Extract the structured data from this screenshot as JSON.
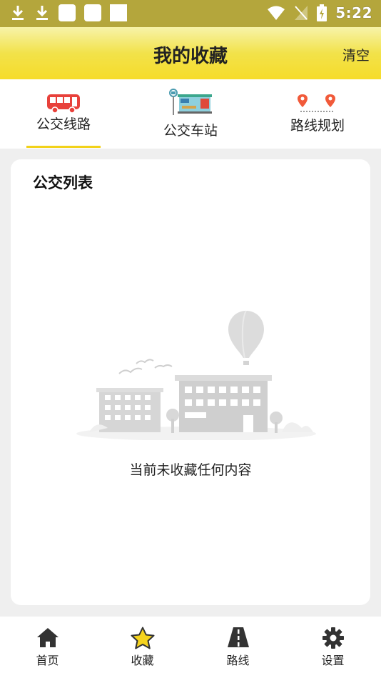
{
  "status_bar": {
    "time": "5:22"
  },
  "header": {
    "title": "我的收藏",
    "clear_label": "清空"
  },
  "tabs": [
    {
      "label": "公交线路",
      "selected": true
    },
    {
      "label": "公交车站",
      "selected": false
    },
    {
      "label": "路线规划",
      "selected": false
    }
  ],
  "card": {
    "title": "公交列表",
    "empty_message": "当前未收藏任何内容"
  },
  "bottom_nav": [
    {
      "label": "首页",
      "icon": "home-icon"
    },
    {
      "label": "收藏",
      "icon": "star-icon"
    },
    {
      "label": "路线",
      "icon": "road-icon"
    },
    {
      "label": "设置",
      "icon": "gear-icon"
    }
  ],
  "colors": {
    "accent": "#f2d21a",
    "bus_red": "#e8413b",
    "status_bar": "#b4a63c"
  }
}
